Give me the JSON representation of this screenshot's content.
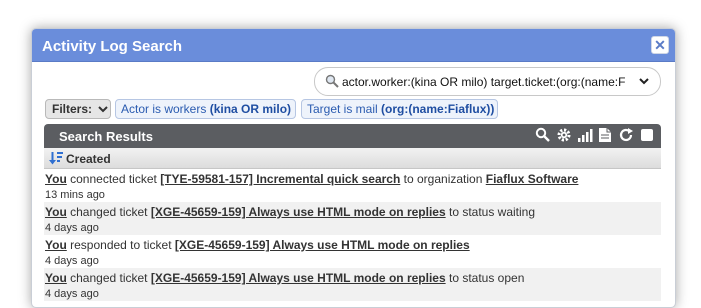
{
  "dialog": {
    "title": "Activity Log Search",
    "close_glyph": "✕"
  },
  "search": {
    "icon": "magnifier-icon",
    "value": "actor.worker:(kina OR milo) target.ticket:(org:(name:F",
    "dropdown_glyph": "▾"
  },
  "filters": {
    "label": "Filters:",
    "chips": [
      {
        "prefix": "Actor is workers",
        "value": "(kina OR milo)"
      },
      {
        "prefix": "Target is mail",
        "value": "(org:(name:Fiaflux))"
      }
    ]
  },
  "results": {
    "title": "Search Results",
    "tools": [
      "search-icon",
      "gear-icon",
      "bar-chart-icon",
      "export-icon",
      "refresh-icon",
      "checkbox-icon"
    ],
    "column": "Created",
    "rows": [
      {
        "actor": "You",
        "verb": "connected ticket",
        "ticket": "[TYE-59581-157] Incremental quick search",
        "suffix": "to organization",
        "target": "Fiaflux Software",
        "time": "13 mins ago"
      },
      {
        "actor": "You",
        "verb": "changed ticket",
        "ticket": "[XGE-45659-159] Always use HTML mode on replies",
        "suffix": "to status waiting",
        "target": "",
        "time": "4 days ago"
      },
      {
        "actor": "You",
        "verb": "responded to ticket",
        "ticket": "[XGE-45659-159] Always use HTML mode on replies",
        "suffix": "",
        "target": "",
        "time": "4 days ago"
      },
      {
        "actor": "You",
        "verb": "changed ticket",
        "ticket": "[XGE-45659-159] Always use HTML mode on replies",
        "suffix": "to status open",
        "target": "",
        "time": "4 days ago"
      }
    ]
  }
}
